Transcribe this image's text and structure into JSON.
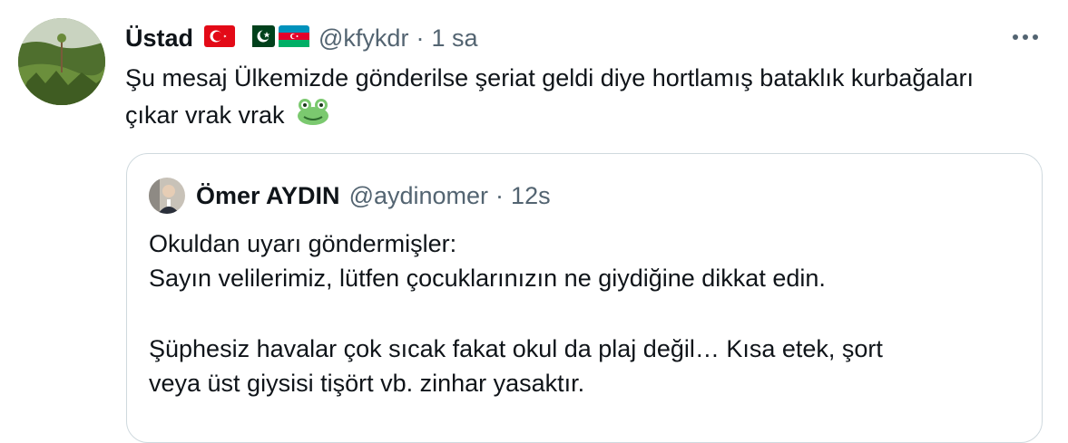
{
  "tweet": {
    "author_name": "Üstad",
    "handle": "@kfykdr",
    "separator": "·",
    "time": "1 sa",
    "flags": [
      "turkey-flag",
      "pakistan-flag",
      "azerbaijan-flag"
    ],
    "text": "Şu mesaj Ülkemizde gönderilse şeriat geldi diye hortlamış bataklık kurbağaları çıkar vrak vrak",
    "emoji": "frog-icon",
    "more_icon": "more-icon"
  },
  "quote": {
    "author_name": "Ömer AYDIN",
    "handle": "@aydinomer",
    "separator": "·",
    "time": "12s",
    "line1": "Okuldan uyarı göndermişler:",
    "line2": "Sayın velilerimiz, lütfen çocuklarınızın ne giydiğine dikkat edin.",
    "line3": "Şüphesiz havalar çok sıcak fakat okul da plaj değil… Kısa etek, şort",
    "line4": "veya üst giysisi tişört vb. zinhar yasaktır."
  },
  "colors": {
    "text": "#0f1419",
    "secondary": "#536471",
    "border": "#cfd9de"
  }
}
